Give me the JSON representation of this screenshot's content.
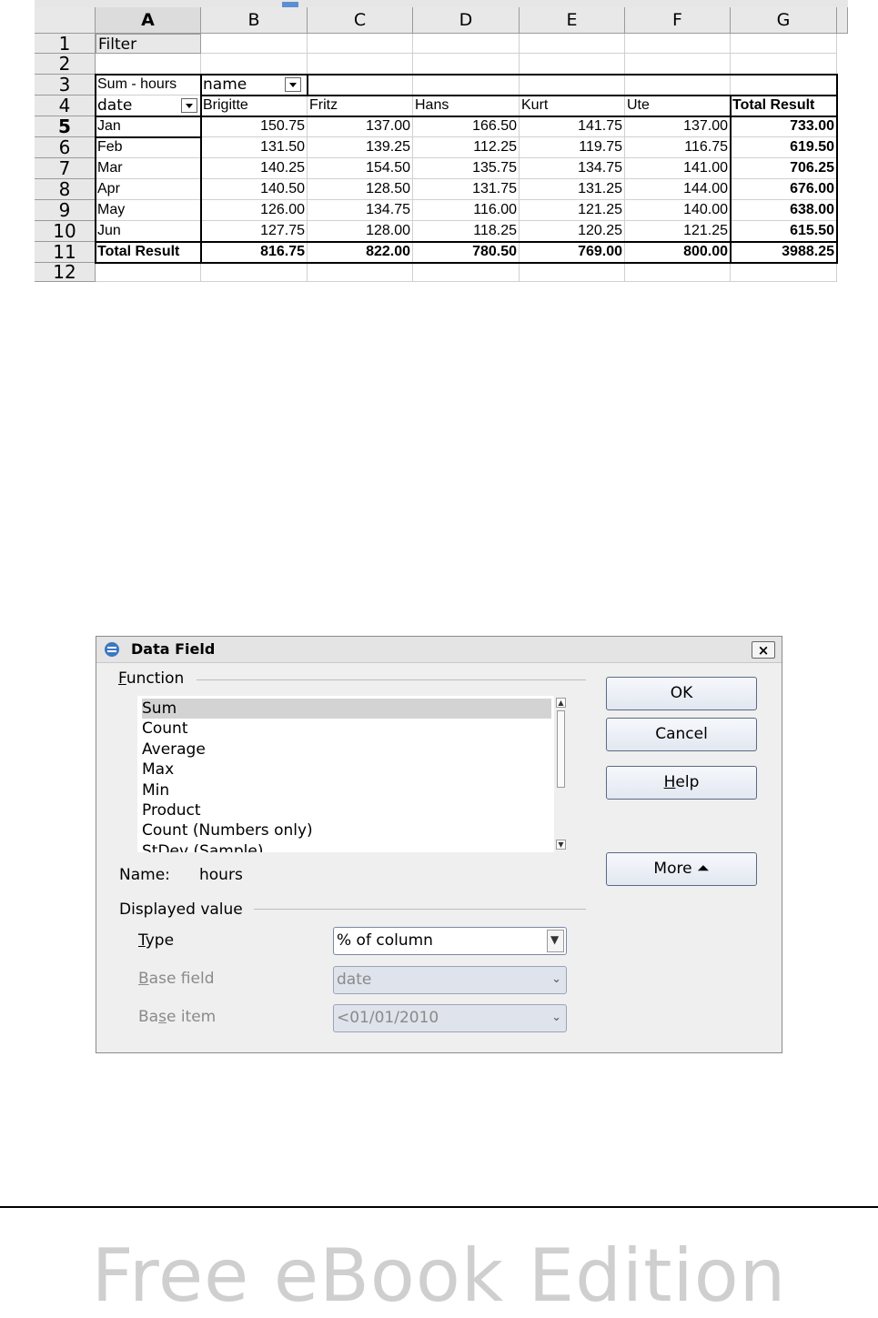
{
  "sheet": {
    "columns": [
      "A",
      "B",
      "C",
      "D",
      "E",
      "F",
      "G"
    ],
    "rows": [
      "1",
      "2",
      "3",
      "4",
      "5",
      "6",
      "7",
      "8",
      "9",
      "10",
      "11",
      "12"
    ],
    "filter_label": "Filter",
    "data_field": "Sum - hours",
    "col_field": "name",
    "row_field": "date",
    "names": [
      "Brigitte",
      "Fritz",
      "Hans",
      "Kurt",
      "Ute"
    ],
    "total_header": "Total Result",
    "pivot_rows": [
      {
        "label": "Jan",
        "values": [
          "150.75",
          "137.00",
          "166.50",
          "141.75",
          "137.00"
        ],
        "total": "733.00"
      },
      {
        "label": "Feb",
        "values": [
          "131.50",
          "139.25",
          "112.25",
          "119.75",
          "116.75"
        ],
        "total": "619.50"
      },
      {
        "label": "Mar",
        "values": [
          "140.25",
          "154.50",
          "135.75",
          "134.75",
          "141.00"
        ],
        "total": "706.25"
      },
      {
        "label": "Apr",
        "values": [
          "140.50",
          "128.50",
          "131.75",
          "131.25",
          "144.00"
        ],
        "total": "676.00"
      },
      {
        "label": "May",
        "values": [
          "126.00",
          "134.75",
          "116.00",
          "121.25",
          "140.00"
        ],
        "total": "638.00"
      },
      {
        "label": "Jun",
        "values": [
          "127.75",
          "128.00",
          "118.25",
          "120.25",
          "121.25"
        ],
        "total": "615.50"
      }
    ],
    "total_row": {
      "label": "Total Result",
      "values": [
        "816.75",
        "822.00",
        "780.50",
        "769.00",
        "800.00"
      ],
      "total": "3988.25"
    }
  },
  "dialog": {
    "title": "Data Field",
    "close_label": "×",
    "function_label": "Function",
    "function_label_mnemonic": "F",
    "function_label_rest": "unction",
    "functions": [
      "Sum",
      "Count",
      "Average",
      "Max",
      "Min",
      "Product",
      "Count (Numbers only)",
      "StDev (Sample)"
    ],
    "selected_function": "Sum",
    "name_label": "Name:",
    "name_value": "hours",
    "displayed_value_label": "Displayed value",
    "type_label_mnemonic": "T",
    "type_label_rest": "ype",
    "type_value": "% of column",
    "base_field_mnemonic": "B",
    "base_field_rest": "ase field",
    "base_field_value": "date",
    "base_item_pre": "Ba",
    "base_item_mnemonic": "s",
    "base_item_rest": "e item",
    "base_item_value": "<01/01/2010",
    "ok_label": "OK",
    "cancel_label": "Cancel",
    "help_mnemonic": "H",
    "help_rest": "elp",
    "more_label": "More",
    "more_icon": "double-chevron-up-icon"
  },
  "footer": {
    "text": "Free eBook Edition"
  }
}
